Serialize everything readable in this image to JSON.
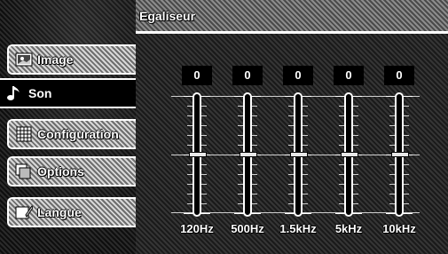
{
  "title": "Egaliseur",
  "sidebar": {
    "items": [
      {
        "label": "Image",
        "icon": "image-icon",
        "active": false
      },
      {
        "label": "Son",
        "icon": "music-note-icon",
        "active": true
      },
      {
        "label": "Configuration",
        "icon": "grid-icon",
        "active": false
      },
      {
        "label": "Options",
        "icon": "options-icon",
        "active": false
      },
      {
        "label": "Langue",
        "icon": "language-icon",
        "active": false
      }
    ]
  },
  "equalizer": {
    "bands": [
      {
        "freq": "120Hz",
        "value": "0"
      },
      {
        "freq": "500Hz",
        "value": "0"
      },
      {
        "freq": "1.5kHz",
        "value": "0"
      },
      {
        "freq": "5kHz",
        "value": "0"
      },
      {
        "freq": "10kHz",
        "value": "0"
      }
    ]
  }
}
